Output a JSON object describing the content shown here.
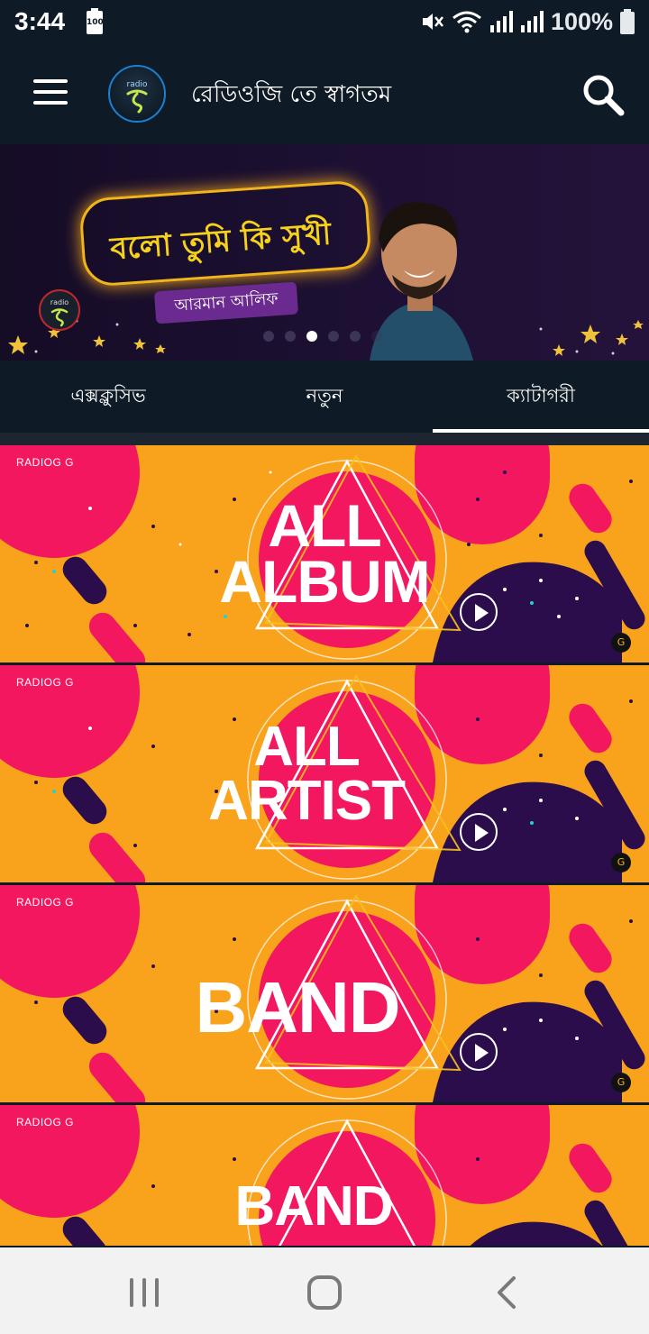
{
  "status_bar": {
    "time": "3:44",
    "battery_small_label": "100",
    "battery_percent": "100%"
  },
  "toolbar": {
    "title": "রেডিওজি তে স্বাগতম",
    "logo_text": "radio"
  },
  "banner": {
    "song_title": "বলো তুমি কি সুখী",
    "artist": "আরমান আলিফ",
    "logo_text": "radio",
    "slides_total": 6,
    "active_slide": 3
  },
  "tabs": [
    {
      "label": "এক্সক্লুসিভ",
      "active": false
    },
    {
      "label": "নতুন",
      "active": false
    },
    {
      "label": "ক্যাটাগরী",
      "active": true
    }
  ],
  "categories": [
    {
      "brand": "RADIOG G",
      "label_line1": "ALL",
      "label_line2": "ALBUM"
    },
    {
      "brand": "RADIOG G",
      "label_line1": "ALL",
      "label_line2": "ARTIST"
    },
    {
      "brand": "RADIOG G",
      "label_line1": "",
      "label_line2": "BAND"
    },
    {
      "brand": "RADIOG G",
      "label_line1": "BAND",
      "label_line2": ""
    }
  ],
  "colors": {
    "background": "#0e1a25",
    "card_orange": "#f9a21b",
    "card_pink": "#f2175f",
    "card_purple": "#2a0d4a",
    "banner_gold": "#f7d21b",
    "nav_bar": "#f2f2f2"
  },
  "icons": {
    "menu": "hamburger-icon",
    "search": "search-icon",
    "play": "play-icon",
    "nav_recents": "recents-icon",
    "nav_home": "home-icon",
    "nav_back": "back-icon"
  }
}
